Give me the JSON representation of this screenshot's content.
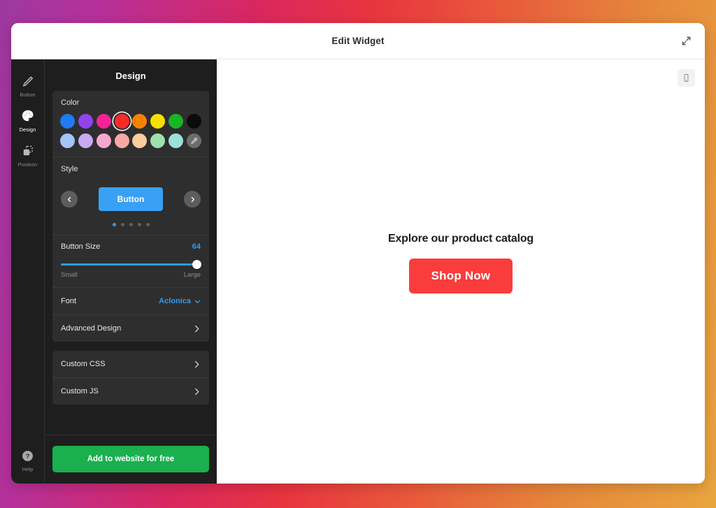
{
  "window": {
    "title": "Edit Widget",
    "expand_icon": "expand-arrows-icon"
  },
  "rail": {
    "items": [
      {
        "label": "Button",
        "icon": "pen-icon",
        "active": false
      },
      {
        "label": "Design",
        "icon": "palette-icon",
        "active": true
      },
      {
        "label": "Position",
        "icon": "position-shapes-icon",
        "active": false
      }
    ],
    "help": {
      "label": "Help",
      "icon": "question-circle-icon"
    }
  },
  "panel": {
    "title": "Design",
    "color": {
      "label": "Color",
      "selected": "#f82a28",
      "row1": [
        {
          "name": "blue",
          "hex": "#1f7bf6"
        },
        {
          "name": "purple",
          "hex": "#9442f0"
        },
        {
          "name": "magenta",
          "hex": "#f52296"
        },
        {
          "name": "red",
          "hex": "#f82a28",
          "selected": true
        },
        {
          "name": "orange",
          "hex": "#fa8100"
        },
        {
          "name": "yellow",
          "hex": "#f9e000"
        },
        {
          "name": "green",
          "hex": "#17b626"
        },
        {
          "name": "black",
          "hex": "#0b0b0b"
        }
      ],
      "row2": [
        {
          "name": "light-blue",
          "hex": "#a2c4f6"
        },
        {
          "name": "light-purple",
          "hex": "#c7aaf0"
        },
        {
          "name": "light-pink",
          "hex": "#f7a8cf"
        },
        {
          "name": "salmon",
          "hex": "#f8a8a5"
        },
        {
          "name": "peach",
          "hex": "#fbcd9b"
        },
        {
          "name": "mint",
          "hex": "#9ee0ad"
        },
        {
          "name": "aqua",
          "hex": "#9ce0da"
        }
      ],
      "eyedropper_icon": "eyedropper-icon"
    },
    "style": {
      "label": "Style",
      "preview_label": "Button",
      "preview_color": "#38a1f5",
      "prev_icon": "chevron-left-icon",
      "next_icon": "chevron-right-icon",
      "dot_count": 5,
      "active_dot": 0
    },
    "button_size": {
      "label": "Button Size",
      "value": "64",
      "min_label": "Small",
      "max_label": "Large",
      "percent": 97
    },
    "font": {
      "label": "Font",
      "value": "Aclonica",
      "chevron_icon": "chevron-down-icon"
    },
    "advanced_design": {
      "label": "Advanced Design",
      "chevron_icon": "chevron-right-icon"
    },
    "custom_css": {
      "label": "Custom CSS",
      "chevron_icon": "chevron-right-icon"
    },
    "custom_js": {
      "label": "Custom JS",
      "chevron_icon": "chevron-right-icon"
    },
    "cta": {
      "label": "Add to website for free",
      "color": "#1ab04e"
    }
  },
  "preview": {
    "device_icon": "mobile-phone-icon",
    "heading": "Explore our product catalog",
    "button_label": "Shop Now",
    "button_color": "#fa3c3c"
  }
}
